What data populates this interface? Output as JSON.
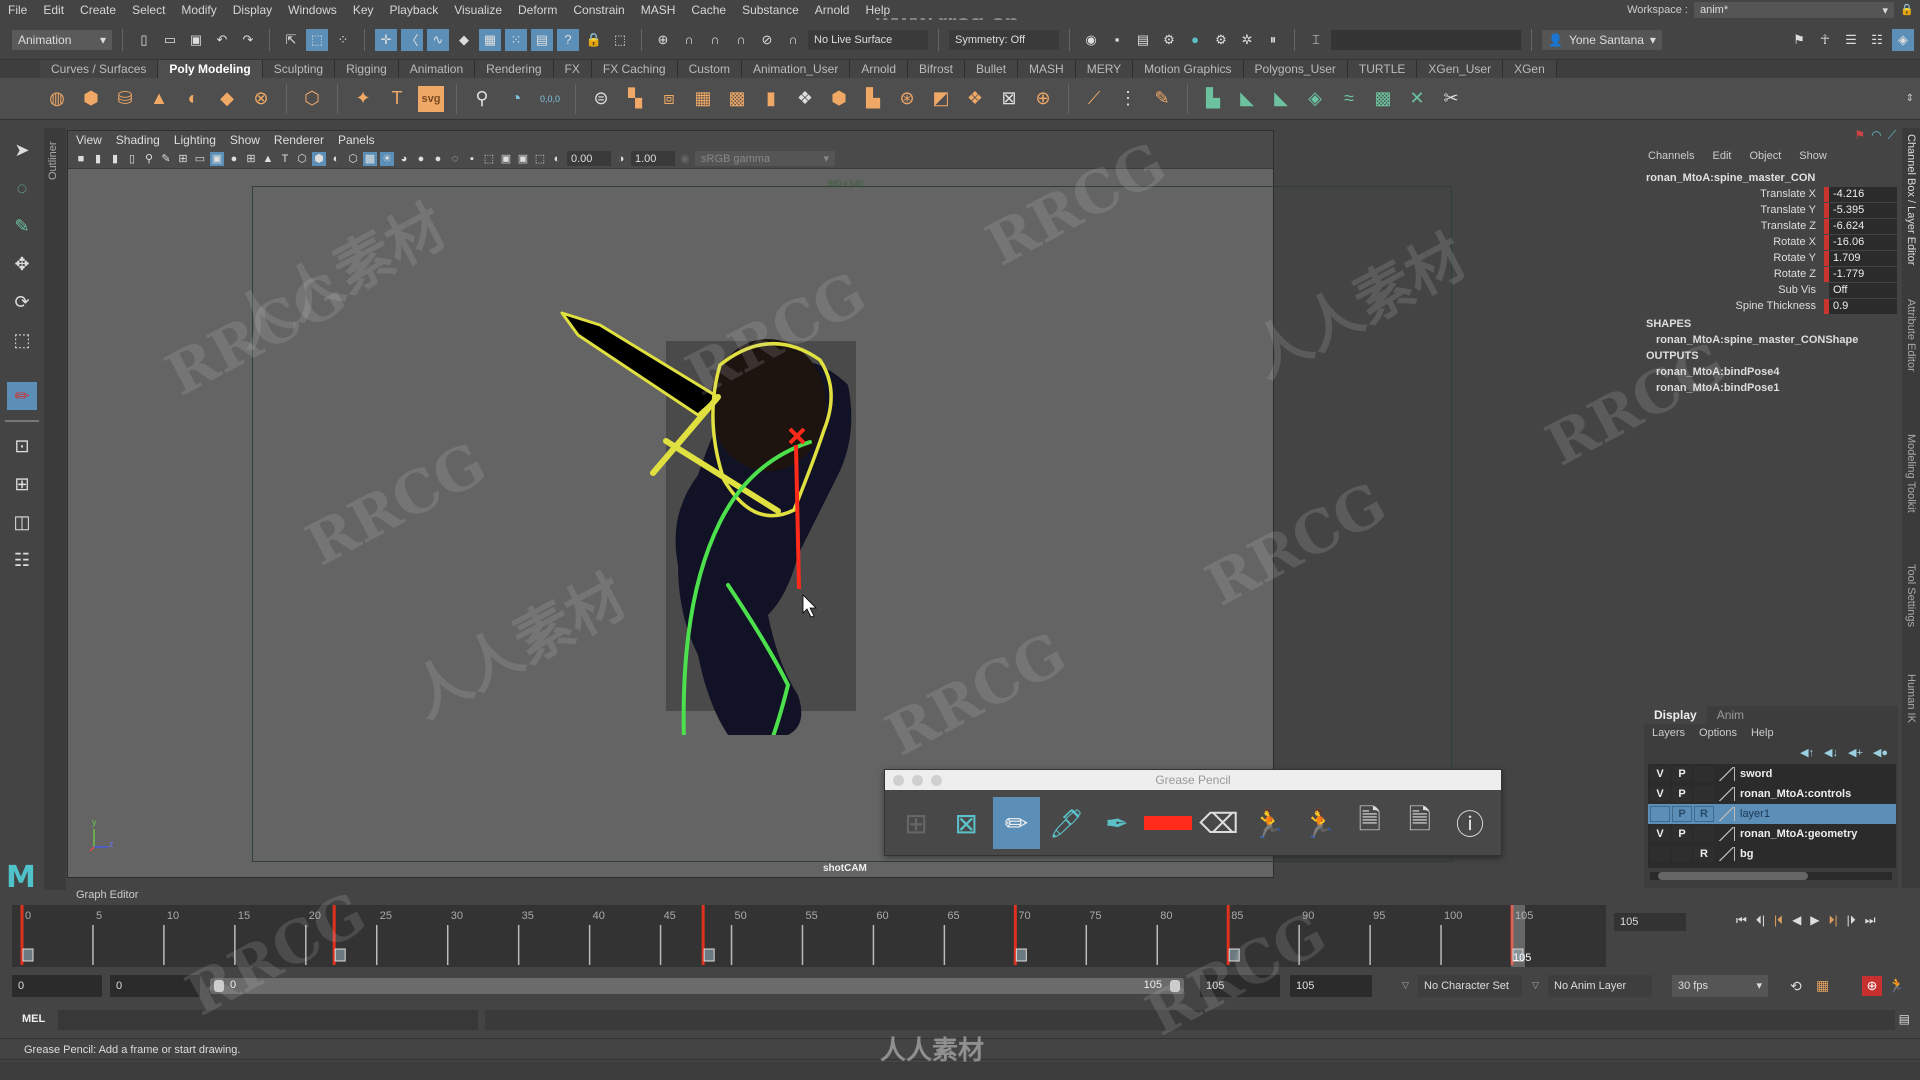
{
  "menubar": {
    "items": [
      "File",
      "Edit",
      "Create",
      "Select",
      "Modify",
      "Display",
      "Windows",
      "Key",
      "Playback",
      "Visualize",
      "Deform",
      "Constrain",
      "MASH",
      "Cache",
      "Substance",
      "Arnold",
      "Help"
    ],
    "workspace_label": "Workspace :",
    "workspace_value": "anim*"
  },
  "statusline": {
    "mode": "Animation",
    "live_surface": "No Live Surface",
    "symmetry": "Symmetry: Off",
    "user": "Yone Santana"
  },
  "shelf": {
    "tabs": [
      "Curves / Surfaces",
      "Poly Modeling",
      "Sculpting",
      "Rigging",
      "Animation",
      "Rendering",
      "FX",
      "FX Caching",
      "Custom",
      "Animation_User",
      "Arnold",
      "Bifrost",
      "Bullet",
      "MASH",
      "MERY",
      "Motion Graphics",
      "Polygons_User",
      "TURTLE",
      "XGen_User",
      "XGen"
    ],
    "active_tab": "Poly Modeling",
    "coord_label": "0,0,0",
    "svg_label": "svg"
  },
  "outliner": {
    "label": "Outliner"
  },
  "viewport": {
    "menu": [
      "View",
      "Shading",
      "Lighting",
      "Show",
      "Renderer",
      "Panels"
    ],
    "exposure": "0.00",
    "gamma": "1.00",
    "colorspace": "sRGB gamma",
    "resolution": "960 x 540",
    "camera": "shotCAM",
    "axis_y": "y",
    "axis_z": "z"
  },
  "grease_pencil": {
    "title": "Grease Pencil",
    "tools": [
      "add-frame",
      "remove-frame",
      "pencil",
      "marker",
      "soft-pencil",
      "color",
      "eraser",
      "ghost-previous",
      "ghost-next",
      "import",
      "export",
      "help"
    ],
    "active_tool": "pencil",
    "color": "#ff2a1a"
  },
  "channel_box": {
    "menu": [
      "Channels",
      "Edit",
      "Object",
      "Show"
    ],
    "object": "ronan_MtoA:spine_master_CON",
    "channels": [
      {
        "label": "Translate X",
        "value": "-4.216",
        "keyed": true
      },
      {
        "label": "Translate Y",
        "value": "-5.395",
        "keyed": true
      },
      {
        "label": "Translate Z",
        "value": "-6.624",
        "keyed": true
      },
      {
        "label": "Rotate X",
        "value": "-16.06",
        "keyed": true
      },
      {
        "label": "Rotate Y",
        "value": "1.709",
        "keyed": true
      },
      {
        "label": "Rotate Z",
        "value": "-1.779",
        "keyed": true
      },
      {
        "label": "Sub Vis",
        "value": "Off",
        "keyed": false
      },
      {
        "label": "Spine Thickness",
        "value": "0.9",
        "keyed": true
      }
    ],
    "shapes_header": "SHAPES",
    "shapes": [
      "ronan_MtoA:spine_master_CONShape"
    ],
    "outputs_header": "OUTPUTS",
    "outputs": [
      "ronan_MtoA:bindPose4",
      "ronan_MtoA:bindPose1"
    ]
  },
  "side_tabs": [
    "Channel Box / Layer Editor",
    "Attribute Editor",
    "Modeling Toolkit",
    "Tool Settings",
    "Human IK"
  ],
  "layer_editor": {
    "tabs": [
      "Display",
      "Anim"
    ],
    "active_tab": "Display",
    "menu": [
      "Layers",
      "Options",
      "Help"
    ],
    "layers": [
      {
        "v": "V",
        "p": "P",
        "r": "",
        "name": "sword",
        "selected": false
      },
      {
        "v": "V",
        "p": "P",
        "r": "",
        "name": "ronan_MtoA:controls",
        "selected": false
      },
      {
        "v": "",
        "p": "P",
        "r": "R",
        "name": "layer1",
        "selected": true
      },
      {
        "v": "V",
        "p": "P",
        "r": "",
        "name": "ronan_MtoA:geometry",
        "selected": false
      },
      {
        "v": "",
        "p": "",
        "r": "R",
        "name": "bg",
        "selected": false
      }
    ]
  },
  "timeline": {
    "tab_label": "Graph Editor",
    "start": 0,
    "end": 105,
    "major_ticks": [
      0,
      5,
      10,
      15,
      20,
      25,
      30,
      35,
      40,
      45,
      50,
      55,
      60,
      65,
      70,
      75,
      80,
      85,
      90,
      95,
      100,
      105
    ],
    "keyframes": [
      0,
      22,
      48,
      70,
      85,
      105
    ],
    "current_frame": 105,
    "current_frame_field": "105",
    "start_field": "0",
    "anim_start_field": "0",
    "range_start": "0",
    "range_end": "105",
    "end_field": "105",
    "anim_end_field": "105",
    "character_set": "No Character Set",
    "anim_layer": "No Anim Layer",
    "fps": "30 fps"
  },
  "command_line": {
    "label": "MEL"
  },
  "help_line": "Grease Pencil: Add a frame or start drawing.",
  "watermarks": {
    "site": "www.rrcg.cn",
    "mark": "RRCG",
    "brand": "人人素材"
  }
}
